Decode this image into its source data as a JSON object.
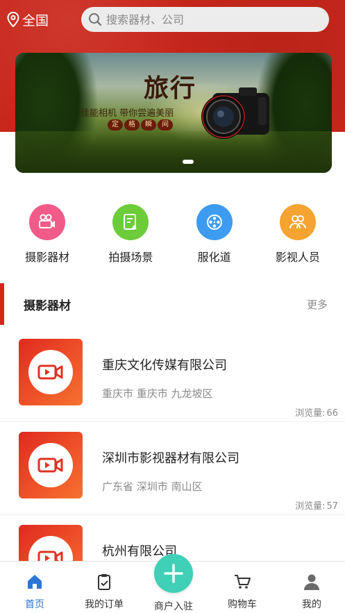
{
  "header": {
    "location": "全国",
    "search_placeholder": "搜索器材、公司"
  },
  "banner": {
    "title": "旅行",
    "subtitle": "佳能相机 带你尝遍美丽",
    "stamps": [
      "定",
      "格",
      "瞬",
      "间"
    ],
    "active_slide": 1
  },
  "categories": [
    {
      "label": "摄影器材",
      "icon": "camera-equipment-icon",
      "color": "#f05b8a"
    },
    {
      "label": "拍摄场景",
      "icon": "scene-icon",
      "color": "#6ccc3a"
    },
    {
      "label": "服化道",
      "icon": "film-reel-icon",
      "color": "#3d9cf0"
    },
    {
      "label": "影视人员",
      "icon": "people-icon",
      "color": "#f5a431"
    }
  ],
  "section": {
    "title": "摄影器材",
    "more": "更多"
  },
  "list": [
    {
      "name": "重庆文化传媒有限公司",
      "address": "重庆市 重庆市 九龙坡区",
      "views_label": "浏览量:",
      "views": "66"
    },
    {
      "name": "深圳市影视器材有限公司",
      "address": "广东省 深圳市 南山区",
      "views_label": "浏览量:",
      "views": "57"
    },
    {
      "name": "杭州有限公司",
      "address": "",
      "views_label": "",
      "views": ""
    }
  ],
  "tabbar": {
    "home": "首页",
    "orders": "我的订单",
    "merchant": "商户入驻",
    "cart": "购物车",
    "mine": "我的"
  },
  "colors": {
    "brand_red": "#c9271b",
    "active_tab": "#2b76d8",
    "fab": "#3fd0b7"
  }
}
